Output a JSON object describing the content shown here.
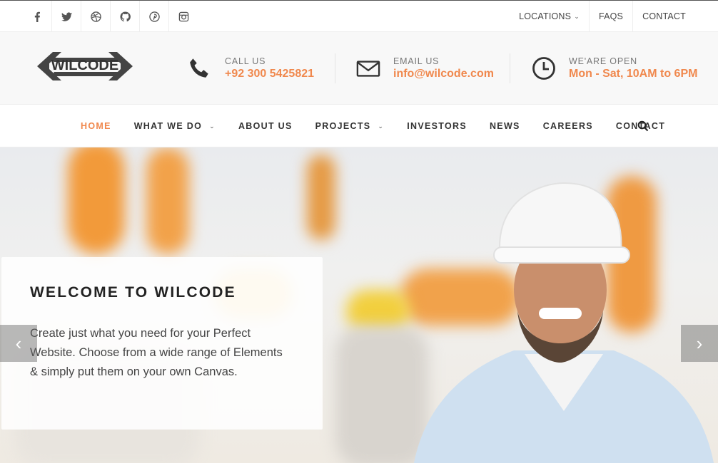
{
  "topbar": {
    "social": [
      "facebook-icon",
      "twitter-icon",
      "dribbble-icon",
      "github-icon",
      "pinterest-icon",
      "instagram-icon"
    ],
    "links": {
      "locations": "LOCATIONS",
      "faqs": "FAQS",
      "contact": "CONTACT"
    }
  },
  "header": {
    "logo_text": "WILCODE",
    "call": {
      "label": "CALL US",
      "value": "+92 300 5425821"
    },
    "email": {
      "label": "EMAIL US",
      "value": "info@wilcode.com"
    },
    "hours": {
      "label": "WE'ARE OPEN",
      "value": "Mon - Sat, 10AM to 6PM"
    }
  },
  "nav": {
    "items": [
      "HOME",
      "WHAT WE DO",
      "ABOUT US",
      "PROJECTS",
      "INVESTORS",
      "NEWS",
      "CAREERS",
      "CONTACT"
    ],
    "active": "HOME"
  },
  "hero": {
    "title": "WELCOME TO WILCODE",
    "text": "Create just what you need for your Perfect Website. Choose from a wide range of Elements & simply put them on your own Canvas."
  },
  "colors": {
    "accent": "#f0884d",
    "topbar_text": "#444444",
    "header_bg": "#f8f8f8"
  }
}
